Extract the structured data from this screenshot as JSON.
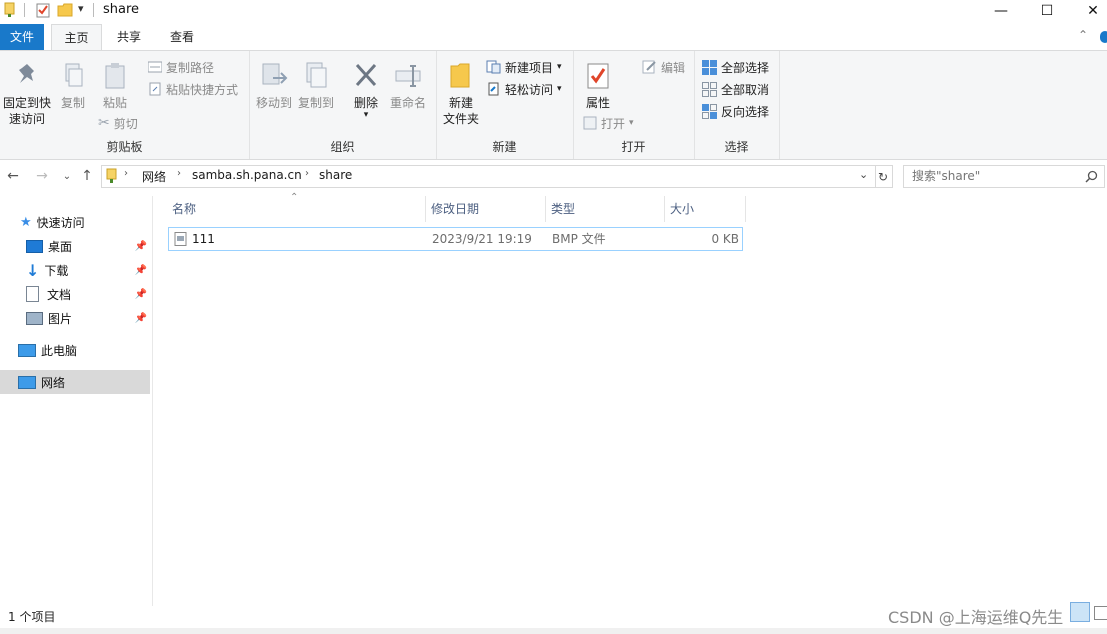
{
  "window": {
    "title": "share",
    "minimize_glyph": "—",
    "maximize_glyph": "☐",
    "close_glyph": "✕"
  },
  "tabs": [
    {
      "label": "文件"
    },
    {
      "label": "主页"
    },
    {
      "label": "共享"
    },
    {
      "label": "查看"
    }
  ],
  "ribbon": {
    "clipboard": {
      "group_label": "剪贴板",
      "pin_label_1": "固定到快",
      "pin_label_2": "速访问",
      "copy": "复制",
      "paste": "粘贴",
      "copy_path": "复制路径",
      "paste_shortcut": "粘贴快捷方式",
      "cut": "剪切"
    },
    "organize": {
      "group_label": "组织",
      "move_to": "移动到",
      "copy_to": "复制到",
      "delete": "删除",
      "rename": "重命名"
    },
    "new": {
      "group_label": "新建",
      "new_folder_1": "新建",
      "new_folder_2": "文件夹",
      "new_item": "新建项目",
      "easy_access": "轻松访问"
    },
    "open": {
      "group_label": "打开",
      "properties": "属性",
      "open": "打开",
      "edit": "编辑"
    },
    "select": {
      "group_label": "选择",
      "select_all": "全部选择",
      "select_none": "全部取消",
      "invert": "反向选择"
    }
  },
  "address": {
    "crumbs": [
      "网络",
      "samba.sh.pana.cn",
      "share"
    ],
    "search_placeholder": "搜索\"share\""
  },
  "navpane": {
    "quick_access": "快速访问",
    "desktop": "桌面",
    "downloads": "下载",
    "documents": "文档",
    "pictures": "图片",
    "this_pc": "此电脑",
    "network": "网络"
  },
  "columns": {
    "name": "名称",
    "modified": "修改日期",
    "type": "类型",
    "size": "大小"
  },
  "files": [
    {
      "name": "111",
      "modified": "2023/9/21 19:19",
      "type": "BMP 文件",
      "size": "0 KB"
    }
  ],
  "status": {
    "count": "1 个项目",
    "watermark": "CSDN @上海运维Q先生"
  },
  "colors": {
    "file_tab": "#1979ca",
    "selection": "#99d1ff",
    "nav_selected": "#d9d9d9"
  }
}
